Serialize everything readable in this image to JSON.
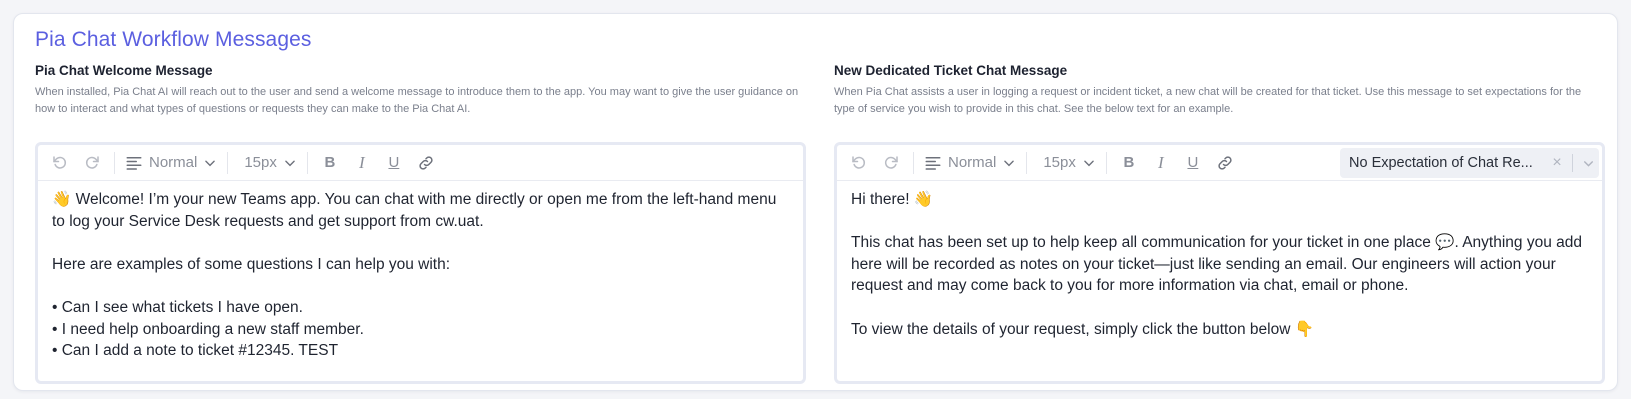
{
  "page": {
    "title": "Pia Chat Workflow Messages"
  },
  "welcome": {
    "title": "Pia Chat Welcome Message",
    "description": "When installed, Pia Chat AI will reach out to the user and send a welcome message to introduce them to the app. You may want to give the user guidance on how to interact and what types of questions or requests they can make to the Pia Chat AI.",
    "toolbar": {
      "format_select": "Normal",
      "size_select": "15px"
    },
    "content": {
      "line1": "👋 Welcome! I’m your new Teams app. You can chat with me directly or open me from the left-hand menu to log your Service Desk requests and get support from cw.uat.",
      "line2": "Here are examples of some questions I can help you with:",
      "bullets": [
        "• Can I see what tickets I have open.",
        "• I need help onboarding a new staff member.",
        "• Can I add a note to ticket #12345. TEST"
      ]
    }
  },
  "ticket": {
    "title": "New Dedicated Ticket Chat Message",
    "description": "When Pia Chat assists a user in logging a request or incident ticket, a new chat will be created for that ticket. Use this message to set expectations for the type of service you wish to provide in this chat. See the below text for an example.",
    "toolbar": {
      "format_select": "Normal",
      "size_select": "15px",
      "template_select": "No Expectation of Chat Re..."
    },
    "content": {
      "greeting": "Hi there! 👋",
      "paragraph": "This chat has been set up to help keep all communication for your ticket in one place 💬. Anything you add here will be recorded as notes on your ticket—just like sending an email. Our engineers will action your request and may come back to you for more information via chat, email or phone.",
      "closing": "To view the details of your request, simply click the button below 👇"
    }
  },
  "colors": {
    "accent": "#5b5fe0",
    "toolbar_icon": "#8b8f99",
    "editor_border": "#e6e9f3"
  }
}
